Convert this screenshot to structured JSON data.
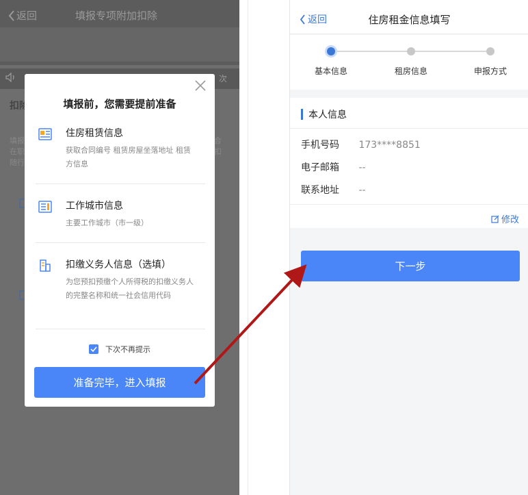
{
  "left_screen": {
    "back_label": "返回",
    "title": "填报专项附加扣除",
    "notice_more": "次",
    "section_title": "扣除",
    "desc_left": "填报\n在职\n随行",
    "desc_right": "合\n扣",
    "modal": {
      "title": "填报前，您需要提前准备",
      "items": [
        {
          "icon": "house-rent-icon",
          "title": "住房租赁信息",
          "desc": "获取合同编号 租赁房屋坐落地址 租赁方信息"
        },
        {
          "icon": "city-list-icon",
          "title": "工作城市信息",
          "desc": "主要工作城市（市一级）"
        },
        {
          "icon": "building-icon",
          "title": "扣缴义务人信息（选填）",
          "desc": "为您预扣预缴个人所得税的扣缴义务人的完整名称和统一社会信用代码"
        }
      ],
      "checkbox_label": "下次不再提示",
      "checkbox_checked": true,
      "confirm_button": "准备完毕，进入填报"
    }
  },
  "right_screen": {
    "back_label": "返回",
    "title": "住房租金信息填写",
    "steps": [
      {
        "label": "基本信息",
        "active": true
      },
      {
        "label": "租房信息",
        "active": false
      },
      {
        "label": "申报方式",
        "active": false
      }
    ],
    "card_title": "本人信息",
    "fields": [
      {
        "label": "手机号码",
        "value": "173****8851"
      },
      {
        "label": "电子邮箱",
        "value": "--"
      },
      {
        "label": "联系地址",
        "value": "--"
      }
    ],
    "edit_label": "修改",
    "next_button": "下一步"
  },
  "colors": {
    "primary": "#4a86f7",
    "link": "#3a78d8",
    "arrow": "#b01818"
  }
}
